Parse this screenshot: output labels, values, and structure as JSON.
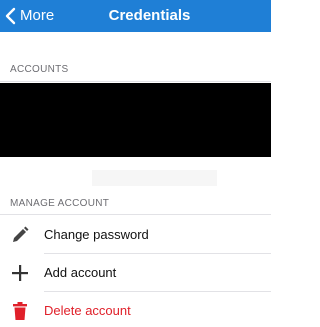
{
  "navbar": {
    "back_label": "More",
    "title": "Credentials",
    "background": "#1f7fd6"
  },
  "accounts": {
    "header": "ACCOUNTS"
  },
  "manage": {
    "header": "MANAGE ACCOUNT",
    "items": [
      {
        "label": "Change password",
        "icon": "pencil-icon"
      },
      {
        "label": "Add account",
        "icon": "plus-icon"
      },
      {
        "label": "Delete account",
        "icon": "trash-icon",
        "color": "#e0202a"
      }
    ]
  }
}
